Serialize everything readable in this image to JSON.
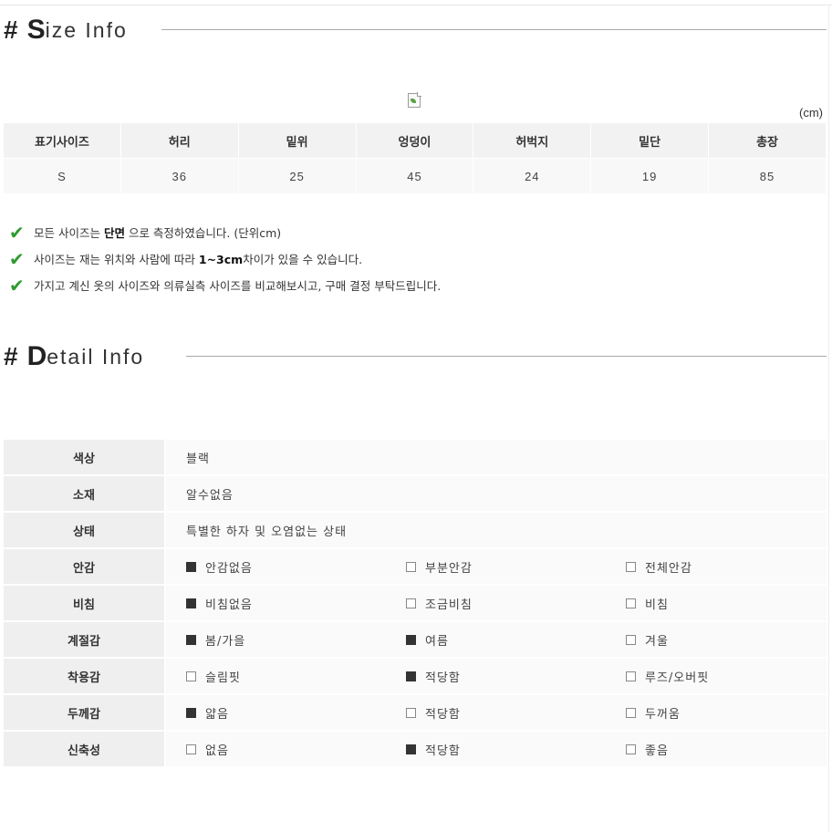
{
  "size_section": {
    "hash": "#",
    "title_initial": "S",
    "title_rest": "ize Info",
    "unit": "(cm)",
    "headers": [
      "표기사이즈",
      "허리",
      "밑위",
      "엉덩이",
      "허벅지",
      "밑단",
      "총장"
    ],
    "rows": [
      [
        "S",
        "36",
        "25",
        "45",
        "24",
        "19",
        "85"
      ]
    ],
    "notes": [
      {
        "before": "모든 사이즈는 ",
        "bold": "단면",
        "after": " 으로 측정하였습니다. (단위cm)"
      },
      {
        "before": "사이즈는 재는 위치와 사람에 따라 ",
        "bold": "1~3cm",
        "after": "차이가 있을 수 있습니다."
      },
      {
        "before": "가지고 계신 옷의 사이즈와 의류실측 사이즈를 비교해보시고, 구매 결정 부탁드립니다.",
        "bold": "",
        "after": ""
      }
    ]
  },
  "detail_section": {
    "hash": "#",
    "title_initial": "D",
    "title_rest": "etail Info",
    "text_rows": [
      {
        "label": "색상",
        "value": "블랙"
      },
      {
        "label": "소재",
        "value": "알수없음"
      },
      {
        "label": "상태",
        "value": "특별한 하자 및 오염없는 상태"
      }
    ],
    "option_rows": [
      {
        "label": "안감",
        "options": [
          {
            "text": "안감없음",
            "checked": true
          },
          {
            "text": "부분안감",
            "checked": false
          },
          {
            "text": "전체안감",
            "checked": false
          }
        ]
      },
      {
        "label": "비침",
        "options": [
          {
            "text": "비침없음",
            "checked": true
          },
          {
            "text": "조금비침",
            "checked": false
          },
          {
            "text": "비침",
            "checked": false
          }
        ]
      },
      {
        "label": "계절감",
        "options": [
          {
            "text": "봄/가을",
            "checked": true
          },
          {
            "text": "여름",
            "checked": true
          },
          {
            "text": "겨울",
            "checked": false
          }
        ]
      },
      {
        "label": "착용감",
        "options": [
          {
            "text": "슬림핏",
            "checked": false
          },
          {
            "text": "적당함",
            "checked": true
          },
          {
            "text": "루즈/오버핏",
            "checked": false
          }
        ]
      },
      {
        "label": "두께감",
        "options": [
          {
            "text": "얇음",
            "checked": true
          },
          {
            "text": "적당함",
            "checked": false
          },
          {
            "text": "두꺼움",
            "checked": false
          }
        ]
      },
      {
        "label": "신축성",
        "options": [
          {
            "text": "없음",
            "checked": false
          },
          {
            "text": "적당함",
            "checked": true
          },
          {
            "text": "좋음",
            "checked": false
          }
        ]
      }
    ]
  },
  "colors": {
    "check_green": "#2f9a2f",
    "checked_box": "#333333",
    "header_bg": "#f2f2f2"
  }
}
